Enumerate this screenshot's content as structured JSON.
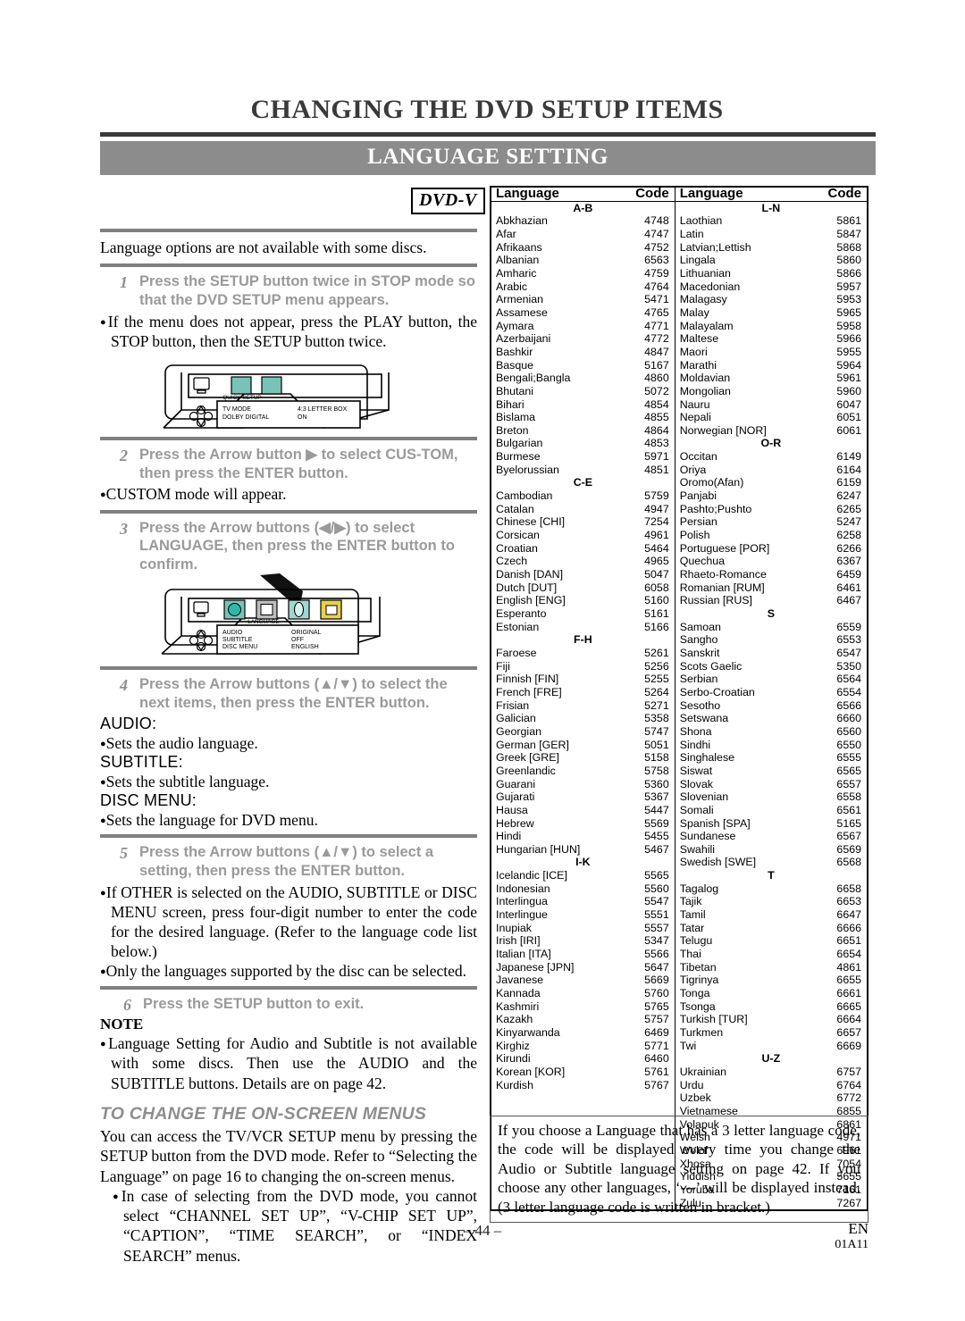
{
  "header": {
    "title": "CHANGING THE DVD SETUP ITEMS",
    "band_title": "LANGUAGE SETTING"
  },
  "left": {
    "dvd_badge": "DVD-V",
    "intro": "Language options are not available with some discs.",
    "step1_num": "1",
    "step1_text": "Press the SETUP button twice in STOP mode so that the DVD SETUP menu appears.",
    "step1_bullet": "If the menu does not appear, press the PLAY button, the STOP button, then the SETUP button twice.",
    "step2_num": "2",
    "step2_text": "Press the Arrow button ▶ to select CUS-TOM, then press the ENTER button.",
    "step2_bullet": "CUSTOM mode will appear.",
    "step3_num": "3",
    "step3_text": "Press the Arrow buttons (◀/▶) to select LANGUAGE, then press the ENTER button to confirm.",
    "step4_num": "4",
    "step4_text": "Press the Arrow buttons (▲/▼) to select the next items, then press the ENTER button.",
    "audio_label": "AUDIO:",
    "audio_bullet": "Sets the audio language.",
    "subtitle_label": "SUBTITLE:",
    "subtitle_bullet": "Sets the subtitle language.",
    "discmenu_label": "DISC MENU:",
    "discmenu_bullet": "Sets the language for DVD menu.",
    "step5_num": "5",
    "step5_text": "Press the Arrow buttons (▲/▼) to select a setting, then press the ENTER button.",
    "step5_bullet1": "If OTHER is selected on the AUDIO, SUBTITLE or DISC MENU screen, press four-digit number to enter the code for the desired language. (Refer to the language code list below.)",
    "step5_bullet2": "Only the languages supported by the disc can be selected.",
    "step6_num": "6",
    "step6_text": "Press the SETUP button to exit.",
    "note_head": "NOTE",
    "note_bullet": "Language Setting for Audio and Subtitle is not available with some discs. Then use the AUDIO and the SUBTITLE buttons. Details are on page 42.",
    "onscreen_head": "TO CHANGE THE ON-SCREEN MENUS",
    "onscreen_para": "You can access the TV/VCR SETUP menu by pressing the SETUP button from the DVD mode. Refer to “Selecting the Language” on page 16 to changing the on-screen menus.",
    "onscreen_bullet": "In case of selecting from the DVD mode, you cannot select “CHANNEL SET UP”, “V-CHIP SET UP”, “CAPTION”, “TIME SEARCH”, or “INDEX SEARCH” menus."
  },
  "figure_quicksetup": {
    "menu_tab": "QUICK SETUP",
    "row1_label": "TV MODE",
    "row1_value": "4:3 LETTER BOX",
    "row2_label": "DOLBY DIGITAL",
    "row2_value": "ON"
  },
  "figure_language": {
    "menu_tab": "LANGUAGE",
    "row1_label": "AUDIO",
    "row1_value": "ORIGINAL",
    "row2_label": "SUBTITLE",
    "row2_value": "OFF",
    "row3_label": "DISC MENU",
    "row3_value": "ENGLISH"
  },
  "table": {
    "headers": {
      "language": "Language",
      "code": "Code"
    },
    "col_left": [
      {
        "group": "A-B"
      },
      {
        "name": "Abkhazian",
        "code": "4748"
      },
      {
        "name": "Afar",
        "code": "4747"
      },
      {
        "name": "Afrikaans",
        "code": "4752"
      },
      {
        "name": "Albanian",
        "code": "6563"
      },
      {
        "name": "Amharic",
        "code": "4759"
      },
      {
        "name": "Arabic",
        "code": "4764"
      },
      {
        "name": "Armenian",
        "code": "5471"
      },
      {
        "name": "Assamese",
        "code": "4765"
      },
      {
        "name": "Aymara",
        "code": "4771"
      },
      {
        "name": "Azerbaijani",
        "code": "4772"
      },
      {
        "name": "Bashkir",
        "code": "4847"
      },
      {
        "name": "Basque",
        "code": "5167"
      },
      {
        "name": "Bengali;Bangla",
        "code": "4860"
      },
      {
        "name": "Bhutani",
        "code": "5072"
      },
      {
        "name": "Bihari",
        "code": "4854"
      },
      {
        "name": "Bislama",
        "code": "4855"
      },
      {
        "name": "Breton",
        "code": "4864"
      },
      {
        "name": "Bulgarian",
        "code": "4853"
      },
      {
        "name": "Burmese",
        "code": "5971"
      },
      {
        "name": "Byelorussian",
        "code": "4851"
      },
      {
        "group": "C-E"
      },
      {
        "name": "Cambodian",
        "code": "5759"
      },
      {
        "name": "Catalan",
        "code": "4947"
      },
      {
        "name": "Chinese [CHI]",
        "code": "7254"
      },
      {
        "name": "Corsican",
        "code": "4961"
      },
      {
        "name": "Croatian",
        "code": "5464"
      },
      {
        "name": "Czech",
        "code": "4965"
      },
      {
        "name": "Danish [DAN]",
        "code": "5047"
      },
      {
        "name": "Dutch [DUT]",
        "code": "6058"
      },
      {
        "name": "English [ENG]",
        "code": "5160"
      },
      {
        "name": "Esperanto",
        "code": "5161"
      },
      {
        "name": "Estonian",
        "code": "5166"
      },
      {
        "group": "F-H"
      },
      {
        "name": "Faroese",
        "code": "5261"
      },
      {
        "name": "Fiji",
        "code": "5256"
      },
      {
        "name": "Finnish [FIN]",
        "code": "5255"
      },
      {
        "name": "French [FRE]",
        "code": "5264"
      },
      {
        "name": "Frisian",
        "code": "5271"
      },
      {
        "name": "Galician",
        "code": "5358"
      },
      {
        "name": "Georgian",
        "code": "5747"
      },
      {
        "name": "German [GER]",
        "code": "5051"
      },
      {
        "name": "Greek [GRE]",
        "code": "5158"
      },
      {
        "name": "Greenlandic",
        "code": "5758"
      },
      {
        "name": "Guarani",
        "code": "5360"
      },
      {
        "name": "Gujarati",
        "code": "5367"
      },
      {
        "name": "Hausa",
        "code": "5447"
      },
      {
        "name": "Hebrew",
        "code": "5569"
      },
      {
        "name": "Hindi",
        "code": "5455"
      },
      {
        "name": "Hungarian [HUN]",
        "code": "5467"
      },
      {
        "group": "I-K"
      },
      {
        "name": "Icelandic [ICE]",
        "code": "5565"
      },
      {
        "name": "Indonesian",
        "code": "5560"
      },
      {
        "name": "Interlingua",
        "code": "5547"
      },
      {
        "name": "Interlingue",
        "code": "5551"
      },
      {
        "name": "Inupiak",
        "code": "5557"
      },
      {
        "name": "Irish [IRI]",
        "code": "5347"
      },
      {
        "name": "Italian [ITA]",
        "code": "5566"
      },
      {
        "name": "Japanese [JPN]",
        "code": "5647"
      },
      {
        "name": "Javanese",
        "code": "5669"
      },
      {
        "name": "Kannada",
        "code": "5760"
      },
      {
        "name": "Kashmiri",
        "code": "5765"
      },
      {
        "name": "Kazakh",
        "code": "5757"
      },
      {
        "name": "Kinyarwanda",
        "code": "6469"
      },
      {
        "name": "Kirghiz",
        "code": "5771"
      },
      {
        "name": "Kirundi",
        "code": "6460"
      },
      {
        "name": "Korean [KOR]",
        "code": "5761"
      },
      {
        "name": "Kurdish",
        "code": "5767"
      }
    ],
    "col_right": [
      {
        "group": "L-N"
      },
      {
        "name": "Laothian",
        "code": "5861"
      },
      {
        "name": "Latin",
        "code": "5847"
      },
      {
        "name": "Latvian;Lettish",
        "code": "5868"
      },
      {
        "name": "Lingala",
        "code": "5860"
      },
      {
        "name": "Lithuanian",
        "code": "5866"
      },
      {
        "name": "Macedonian",
        "code": "5957"
      },
      {
        "name": "Malagasy",
        "code": "5953"
      },
      {
        "name": "Malay",
        "code": "5965"
      },
      {
        "name": "Malayalam",
        "code": "5958"
      },
      {
        "name": "Maltese",
        "code": "5966"
      },
      {
        "name": "Maori",
        "code": "5955"
      },
      {
        "name": "Marathi",
        "code": "5964"
      },
      {
        "name": "Moldavian",
        "code": "5961"
      },
      {
        "name": "Mongolian",
        "code": "5960"
      },
      {
        "name": "Nauru",
        "code": "6047"
      },
      {
        "name": "Nepali",
        "code": "6051"
      },
      {
        "name": "Norwegian [NOR]",
        "code": "6061"
      },
      {
        "group": "O-R"
      },
      {
        "name": "Occitan",
        "code": "6149"
      },
      {
        "name": "Oriya",
        "code": "6164"
      },
      {
        "name": "Oromo(Afan)",
        "code": "6159"
      },
      {
        "name": "Panjabi",
        "code": "6247"
      },
      {
        "name": "Pashto;Pushto",
        "code": "6265"
      },
      {
        "name": "Persian",
        "code": "5247"
      },
      {
        "name": "Polish",
        "code": "6258"
      },
      {
        "name": "Portuguese [POR]",
        "code": "6266"
      },
      {
        "name": "Quechua",
        "code": "6367"
      },
      {
        "name": "Rhaeto-Romance",
        "code": "6459"
      },
      {
        "name": "Romanian [RUM]",
        "code": "6461"
      },
      {
        "name": "Russian [RUS]",
        "code": "6467"
      },
      {
        "group": "S"
      },
      {
        "name": "Samoan",
        "code": "6559"
      },
      {
        "name": "Sangho",
        "code": "6553"
      },
      {
        "name": "Sanskrit",
        "code": "6547"
      },
      {
        "name": "Scots Gaelic",
        "code": "5350"
      },
      {
        "name": "Serbian",
        "code": "6564"
      },
      {
        "name": "Serbo-Croatian",
        "code": "6554"
      },
      {
        "name": "Sesotho",
        "code": "6566"
      },
      {
        "name": "Setswana",
        "code": "6660"
      },
      {
        "name": "Shona",
        "code": "6560"
      },
      {
        "name": "Sindhi",
        "code": "6550"
      },
      {
        "name": "Singhalese",
        "code": "6555"
      },
      {
        "name": "Siswat",
        "code": "6565"
      },
      {
        "name": "Slovak",
        "code": "6557"
      },
      {
        "name": "Slovenian",
        "code": "6558"
      },
      {
        "name": "Somali",
        "code": "6561"
      },
      {
        "name": "Spanish [SPA]",
        "code": "5165"
      },
      {
        "name": "Sundanese",
        "code": "6567"
      },
      {
        "name": "Swahili",
        "code": "6569"
      },
      {
        "name": "Swedish [SWE]",
        "code": "6568"
      },
      {
        "group": "T"
      },
      {
        "name": "Tagalog",
        "code": "6658"
      },
      {
        "name": "Tajik",
        "code": "6653"
      },
      {
        "name": "Tamil",
        "code": "6647"
      },
      {
        "name": "Tatar",
        "code": "6666"
      },
      {
        "name": "Telugu",
        "code": "6651"
      },
      {
        "name": "Thai",
        "code": "6654"
      },
      {
        "name": "Tibetan",
        "code": "4861"
      },
      {
        "name": "Tigrinya",
        "code": "6655"
      },
      {
        "name": "Tonga",
        "code": "6661"
      },
      {
        "name": "Tsonga",
        "code": "6665"
      },
      {
        "name": "Turkish [TUR]",
        "code": "6664"
      },
      {
        "name": "Turkmen",
        "code": "6657"
      },
      {
        "name": "Twi",
        "code": "6669"
      },
      {
        "group": "U-Z"
      },
      {
        "name": "Ukrainian",
        "code": "6757"
      },
      {
        "name": "Urdu",
        "code": "6764"
      },
      {
        "name": "Uzbek",
        "code": "6772"
      },
      {
        "name": "Vietnamese",
        "code": "6855"
      },
      {
        "name": "Volapuk",
        "code": "6861"
      },
      {
        "name": "Welsh",
        "code": "4971"
      },
      {
        "name": "Wolof",
        "code": "6961"
      },
      {
        "name": "Xhosa",
        "code": "7054"
      },
      {
        "name": "Yiddish",
        "code": "5655"
      },
      {
        "name": "Yoruba",
        "code": "7161"
      },
      {
        "name": "Zulu",
        "code": "7267"
      }
    ]
  },
  "bottom_note": "If you choose a Language that has a 3 letter language code, the code will be displayed every time you change the Audio or Subtitle language setting on page 42. If you choose any other languages, ‘---’ will be displayed instead. (3 letter language code is written in bracket.)",
  "footer": {
    "page_number": "– 44 –",
    "region": "EN",
    "doc_code": "01A11"
  }
}
